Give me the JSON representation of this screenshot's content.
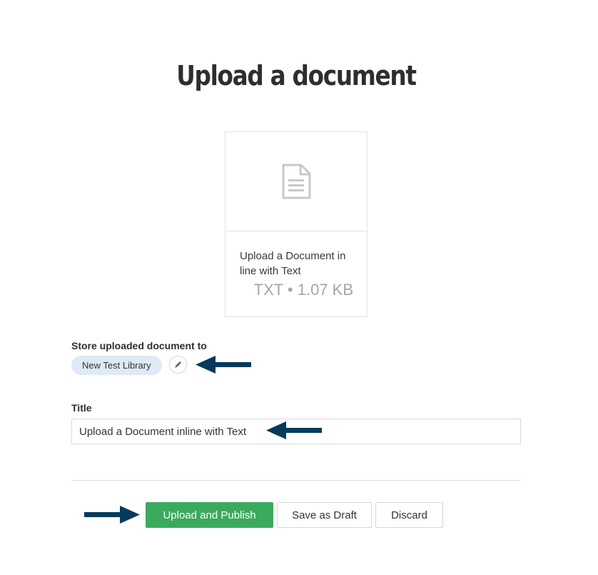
{
  "page": {
    "title": "Upload a document"
  },
  "document_card": {
    "icon": "document-icon",
    "name": "Upload a Document in line with Text",
    "meta": "TXT • 1.07 KB"
  },
  "storage": {
    "label": "Store uploaded document to",
    "library": "New Test Library",
    "edit_icon": "pencil-icon"
  },
  "title_field": {
    "label": "Title",
    "value": "Upload a Document inline with Text"
  },
  "actions": {
    "publish_label": "Upload and Publish",
    "draft_label": "Save as Draft",
    "discard_label": "Discard"
  },
  "annotations": {
    "arrow_icon": "arrow-icon",
    "arrow_color": "#063a5c"
  },
  "colors": {
    "primary": "#3aaa5c",
    "chip": "#deeaf5"
  }
}
